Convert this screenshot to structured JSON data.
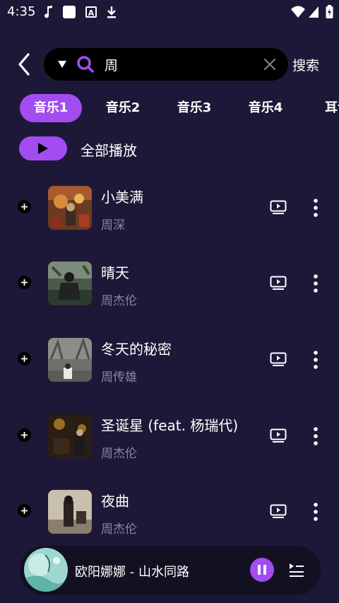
{
  "status_bar": {
    "time": "4:35"
  },
  "search": {
    "value": "周",
    "submit_label": "搜索"
  },
  "tabs": [
    {
      "label": "音乐1",
      "active": true
    },
    {
      "label": "音乐2",
      "active": false
    },
    {
      "label": "音乐3",
      "active": false
    },
    {
      "label": "音乐4",
      "active": false
    },
    {
      "label": "耳语",
      "active": false
    }
  ],
  "play_all": {
    "label": "全部播放"
  },
  "songs": [
    {
      "title": "小美满",
      "artist": "周深"
    },
    {
      "title": "晴天",
      "artist": "周杰伦"
    },
    {
      "title": "冬天的秘密",
      "artist": "周传雄"
    },
    {
      "title": "圣诞星 (feat. 杨瑞代)",
      "artist": "周杰伦"
    },
    {
      "title": "夜曲",
      "artist": "周杰伦"
    }
  ],
  "now_playing": {
    "title": "欧阳娜娜 - 山水同路"
  },
  "colors": {
    "background": "#1d1838",
    "accent": "#a24cf2",
    "muted_text": "#8a8799"
  },
  "icons": [
    "music-note-icon",
    "square-icon",
    "a-icon",
    "download-icon",
    "wifi-icon",
    "signal-icon",
    "battery-icon",
    "back-arrow-icon",
    "caret-down-icon",
    "search-icon",
    "close-icon",
    "play-icon",
    "add-icon",
    "video-icon",
    "more-vertical-icon",
    "pause-icon",
    "playlist-icon"
  ]
}
